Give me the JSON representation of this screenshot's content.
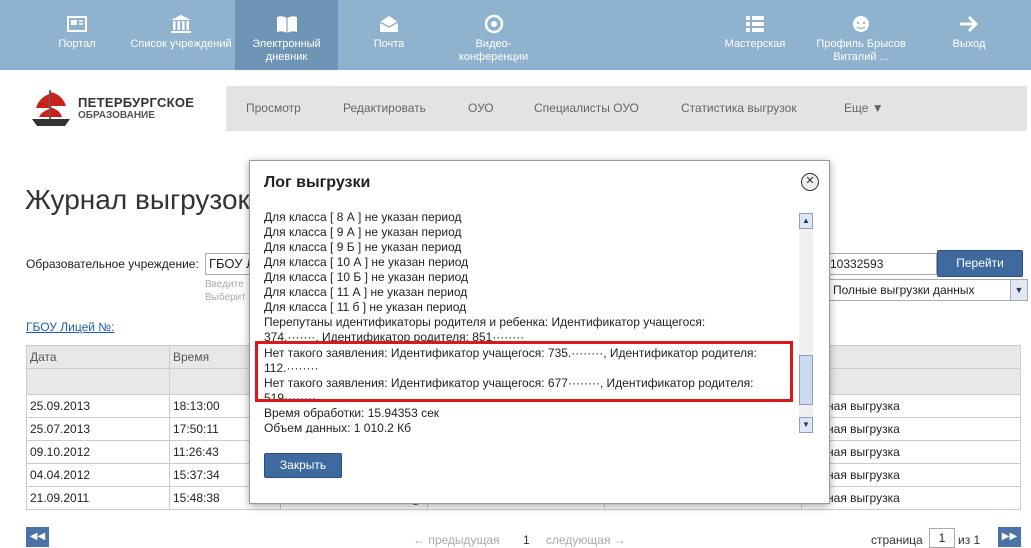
{
  "topnav": {
    "items": [
      {
        "label": "Портал",
        "icon": "portal-icon"
      },
      {
        "label": "Список учреждений",
        "icon": "institution-icon"
      },
      {
        "label": "Электронный дневник",
        "icon": "diary-icon"
      },
      {
        "label": "Почта",
        "icon": "mail-icon"
      },
      {
        "label": "Видео-конференции",
        "icon": "video-icon"
      },
      {
        "label": "Мастерская",
        "icon": "workshop-icon"
      },
      {
        "label": "Профиль Брысов Виталий ...",
        "icon": "profile-icon"
      },
      {
        "label": "Выход",
        "icon": "exit-icon"
      }
    ]
  },
  "logo": {
    "line1": "ПЕТЕРБУРГСКОЕ",
    "line2": "ОБРАЗОВАНИЕ"
  },
  "subnav": {
    "items": [
      "Просмотр",
      "Редактировать",
      "ОУО",
      "Специалисты ОУО",
      "Статистика выгрузок",
      "Еще ▼"
    ]
  },
  "page": {
    "title": "Журнал выгрузок",
    "filter_label": "Образовательное учреждение:",
    "filter_value": "ГБОУ Л",
    "hint1": "Введите",
    "hint2": "Выберит",
    "school_link": "ГБОУ Лицей №:",
    "id_value": "10332593",
    "go_button": "Перейти",
    "type_select": "Полные выгрузки данных"
  },
  "table": {
    "headers": [
      "Дата",
      "Время"
    ],
    "rows": [
      {
        "date": "25.09.2013",
        "time": "18:13:00",
        "type": "Полная выгрузка"
      },
      {
        "date": "25.07.2013",
        "time": "17:50:11",
        "type": "Полная выгрузка"
      },
      {
        "date": "09.10.2012",
        "time": "11:26:43",
        "type": "Полная выгрузка"
      },
      {
        "date": "04.04.2012",
        "time": "15:37:34",
        "type": "Полная выгрузка"
      },
      {
        "date": "21.09.2011",
        "time": "15:48:38",
        "status": "ok",
        "type": "Полная выгрузка"
      }
    ]
  },
  "pager": {
    "prev": "← предыдущая",
    "current": "1",
    "next": "следующая →",
    "page_label": "страница",
    "page_value": "1",
    "of_label": "из 1"
  },
  "modal": {
    "title": "Лог выгрузки",
    "lines": [
      "Для класса [ 8 А ] не указан период",
      "Для класса [ 9 А ] не указан период",
      "Для класса [ 9 Б ] не указан период",
      "Для класса [ 10 А ] не указан период",
      "Для класса [ 10 Б ] не указан период",
      "Для класса [ 11 А ] не указан период",
      "Для класса [ 11 б ] не указан период",
      "Перепутаны идентификаторы родителя и ребенка: Идентификатор учащегося:",
      "374.·······, Идентификатор родителя: 851········",
      "Нет такого заявления: Идентификатор учащегося: 735.········, Идентификатор родителя:",
      "112.········",
      "Нет такого заявления: Идентификатор учащегося: 677········, Идентификатор родителя:",
      "519········",
      "Время обработки: 15.94353 сек",
      "Объем данных: 1 010.2 Кб"
    ],
    "close_button": "Закрыть"
  }
}
